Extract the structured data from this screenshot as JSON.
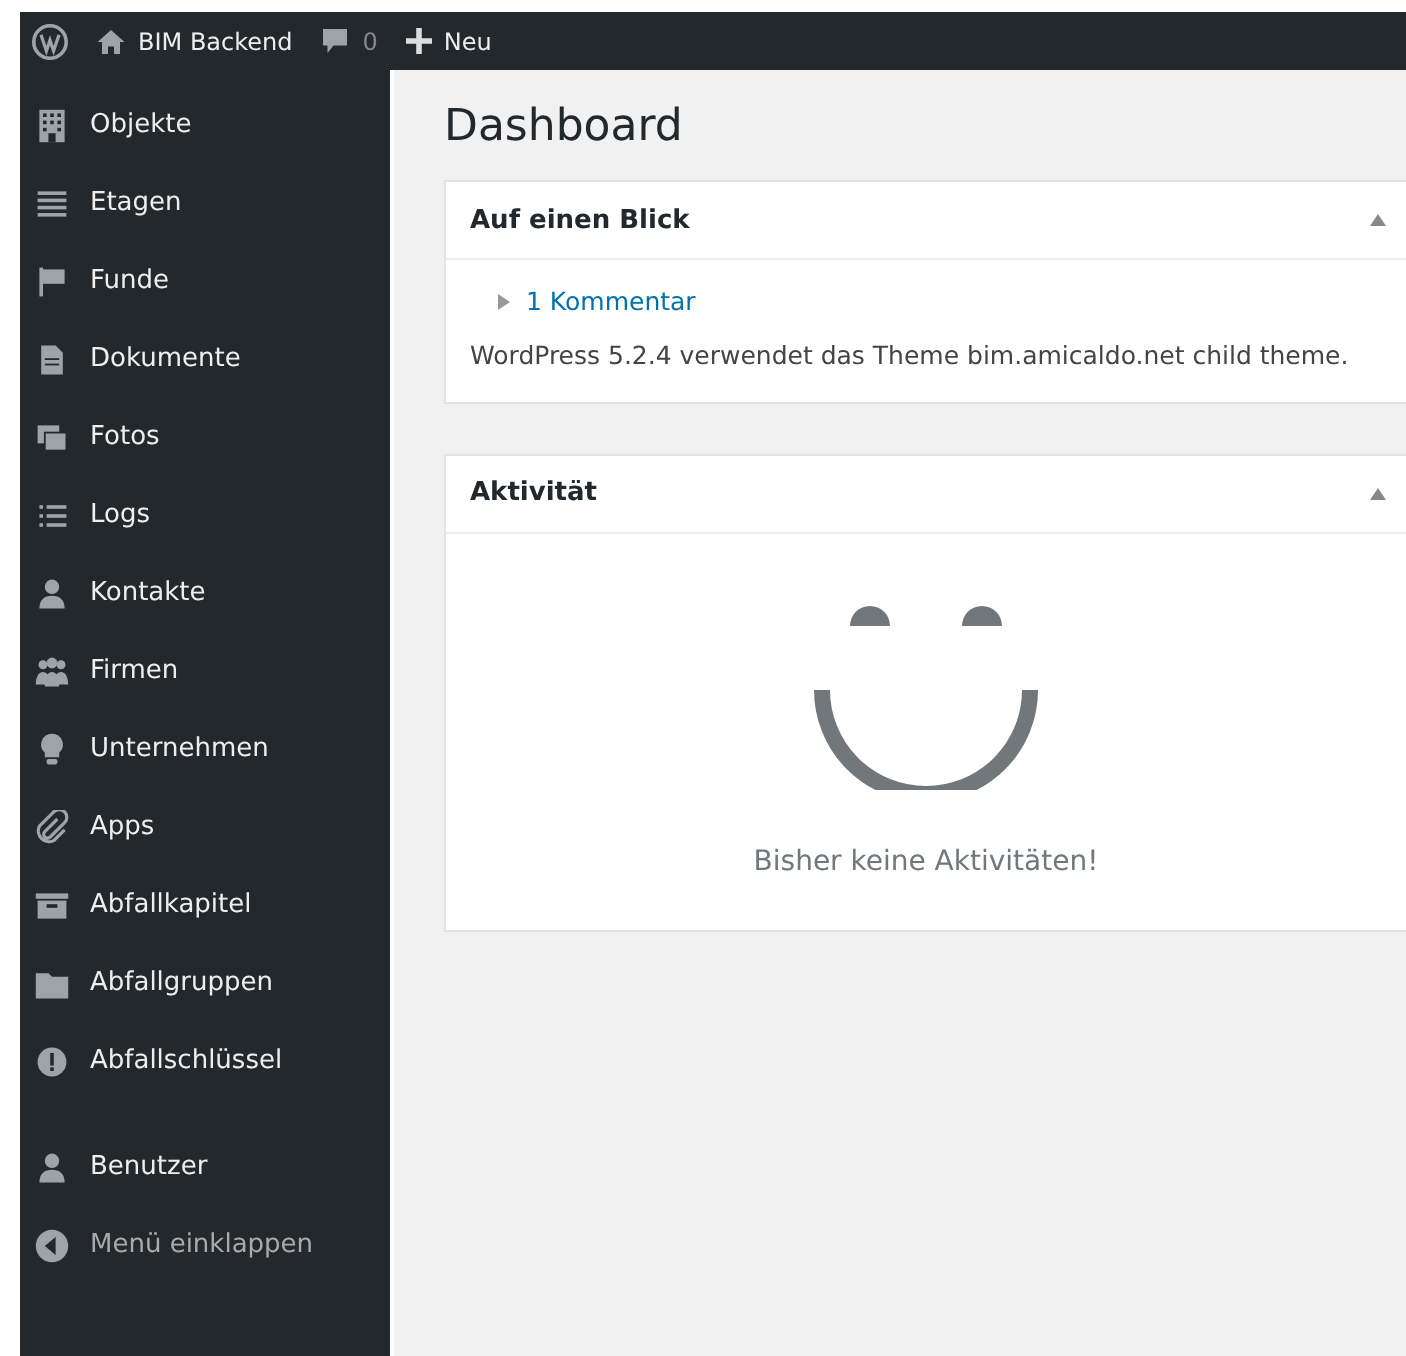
{
  "admin_bar": {
    "site_name": "BIM Backend",
    "comment_count": "0",
    "new_label": "Neu"
  },
  "sidebar": {
    "groups": [
      [
        "Objekte",
        "Etagen",
        "Funde",
        "Dokumente",
        "Fotos",
        "Logs",
        "Kontakte",
        "Firmen",
        "Unternehmen",
        "Apps",
        "Abfallkapitel",
        "Abfallgruppen",
        "Abfallschlüssel"
      ],
      [
        "Benutzer"
      ]
    ],
    "collapse_label": "Menü einklappen"
  },
  "page_title": "Dashboard",
  "panels": [
    {
      "kind": "glance",
      "title": "Auf einen Blick",
      "expanded": true,
      "link": "1 Kommentar",
      "text": "WordPress 5.2.4 verwendet das Theme bim.amicaldo.net child theme."
    },
    {
      "kind": "activity",
      "title": "Aktivität",
      "expanded": true,
      "text": "Bisher keine Aktivitäten!"
    }
  ]
}
